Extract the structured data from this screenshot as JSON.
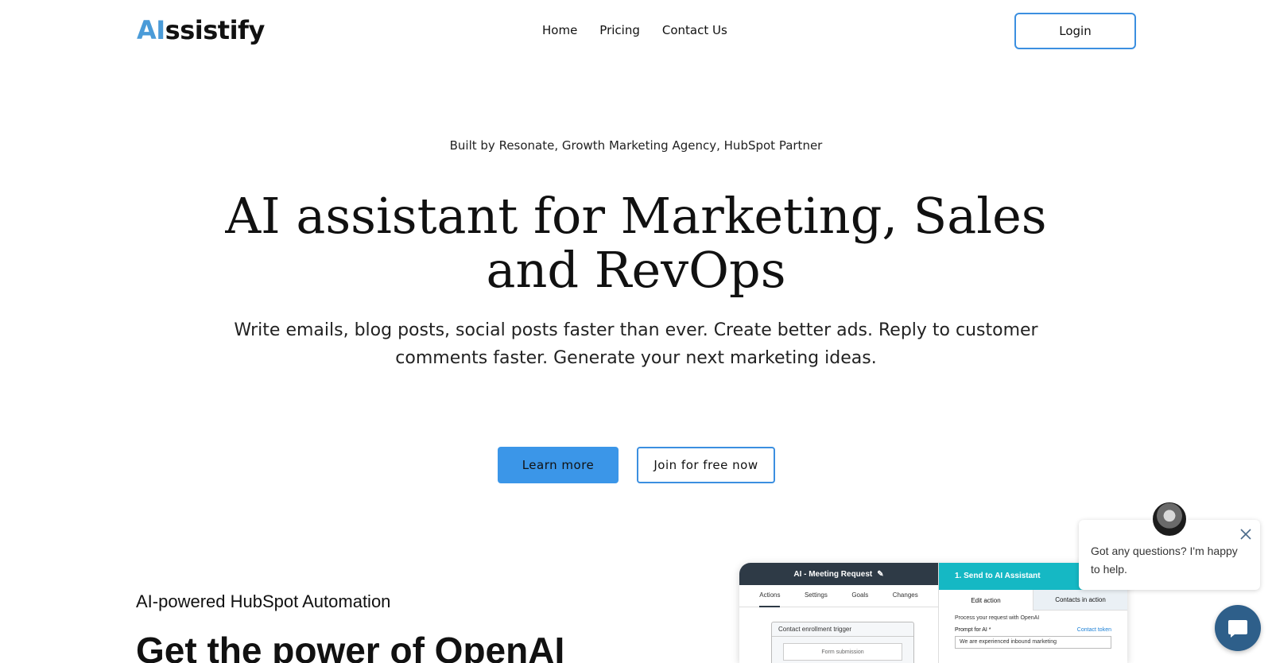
{
  "brand": {
    "logo_ai": "AI",
    "logo_rest": "ssistify"
  },
  "nav": {
    "items": [
      "Home",
      "Pricing",
      "Contact Us"
    ],
    "login_label": "Login"
  },
  "hero": {
    "eyebrow": "Built by Resonate, Growth Marketing Agency, HubSpot Partner",
    "title_line1": "AI assistant for Marketing, Sales",
    "title_line2": "and RevOps",
    "subtitle_line1": "Write emails, blog posts, social posts faster than ever. Create better ads. Reply to customer",
    "subtitle_line2": "comments faster. Generate your next marketing ideas.",
    "learn_more_label": "Learn more",
    "join_label": "Join for free now"
  },
  "section": {
    "eyebrow": "AI-powered HubSpot Automation",
    "title": "Get the power of OpenAI"
  },
  "mock": {
    "left_title": "AI - Meeting Request",
    "left_tabs": [
      "Actions",
      "Settings",
      "Goals",
      "Changes"
    ],
    "trigger_label": "Contact enrollment trigger",
    "trigger_inner": "Form submission",
    "right_title": "1. Send to AI Assistant",
    "right_tabs": [
      "Edit action",
      "Contacts in action"
    ],
    "process_text": "Process your request with OpenAI",
    "prompt_label": "Prompt for AI *",
    "token_label": "Contact token",
    "input_text": "We are experienced inbound marketing"
  },
  "chat": {
    "message": "Got any questions? I'm happy to help."
  },
  "colors": {
    "accent": "#3b96e8",
    "logo_ai": "#4a9bd8",
    "mock_dark": "#2e3a46",
    "mock_teal": "#15b8c4",
    "chat_launcher": "#2e5f8a"
  },
  "icons": [
    "close-icon",
    "chat-icon",
    "pencil-icon"
  ]
}
